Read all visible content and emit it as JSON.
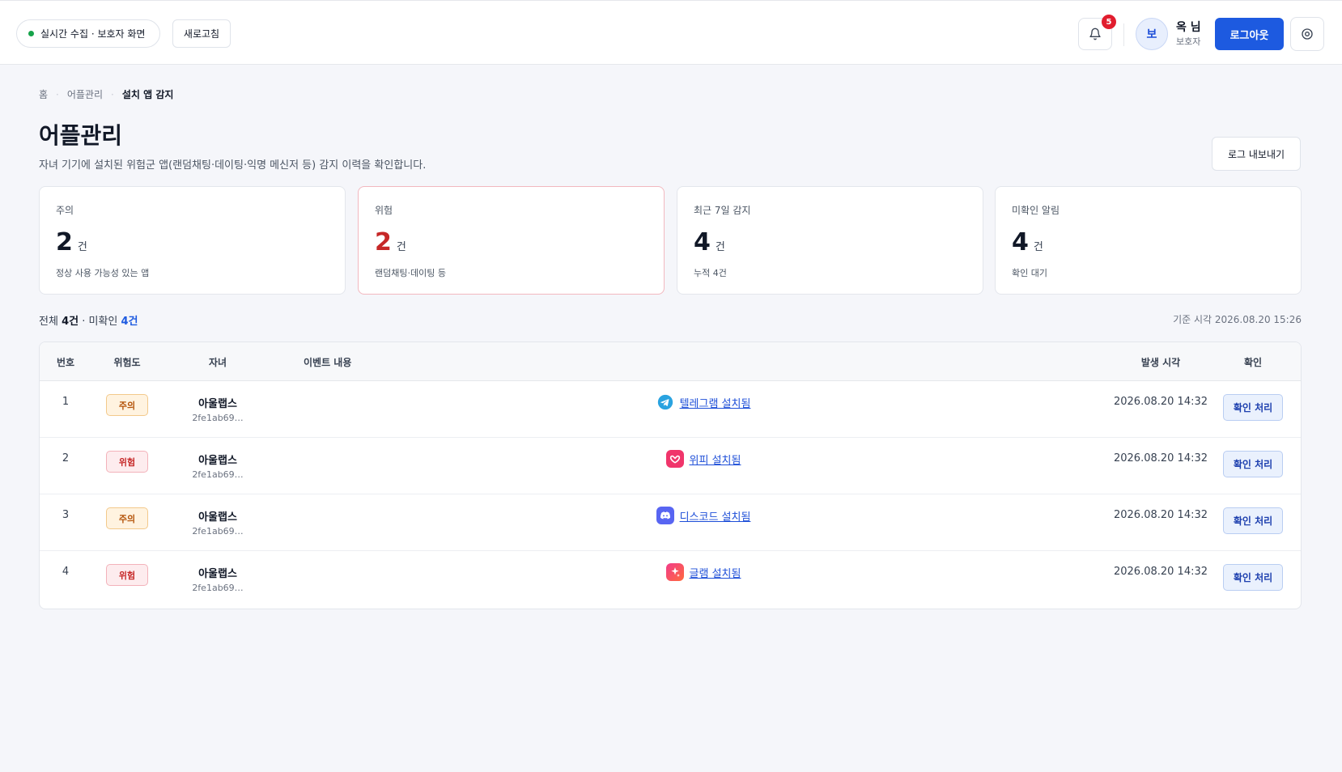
{
  "header": {
    "status_label": "실시간 수집 · 보호자 화면",
    "refresh_label": "새로고침",
    "notification_count": "5",
    "avatar_initial": "보",
    "user_name": "옥 님",
    "user_role": "보호자",
    "logout_label": "로그아웃"
  },
  "breadcrumb": [
    "홈",
    "어플관리",
    "설치 앱 감지"
  ],
  "page": {
    "title": "어플관리",
    "description": "자녀 기기에 설치된 위험군 앱(랜덤채팅·데이팅·익명 메신저 등) 감지 이력을 확인합니다.",
    "export_label": "로그 내보내기"
  },
  "stats": [
    {
      "label": "주의",
      "value": "2",
      "unit": "건",
      "sub": "정상 사용 가능성 있는 앱"
    },
    {
      "label": "위험",
      "value": "2",
      "unit": "건",
      "sub": "랜덤채팅·데이팅 등"
    },
    {
      "label": "최근 7일 감지",
      "value": "4",
      "unit": "건",
      "sub": "누적 4건"
    },
    {
      "label": "미확인 알림",
      "value": "4",
      "unit": "건",
      "sub": "확인 대기"
    }
  ],
  "summary": {
    "total_prefix": "전체",
    "total_value": "4건",
    "unread_prefix": "· 미확인",
    "unread_value": "4건",
    "timestamp": "기준 시각 2026.08.20 15:26"
  },
  "table": {
    "headers": [
      "번호",
      "위험도",
      "자녀",
      "이벤트 내용",
      "발생 시각",
      "확인"
    ],
    "rows": [
      {
        "no": "1",
        "risk": "주의",
        "child": "아울랩스",
        "child_id": "2fe1ab69…",
        "event": "텔레그램 설치됨",
        "icon": "telegram-icon",
        "time": "2026.08.20 14:32",
        "action": "확인 처리"
      },
      {
        "no": "2",
        "risk": "위험",
        "child": "아울랩스",
        "child_id": "2fe1ab69…",
        "event": "위피 설치됨",
        "icon": "wippy-icon",
        "time": "2026.08.20 14:32",
        "action": "확인 처리"
      },
      {
        "no": "3",
        "risk": "주의",
        "child": "아울랩스",
        "child_id": "2fe1ab69…",
        "event": "디스코드 설치됨",
        "icon": "discord-icon",
        "time": "2026.08.20 14:32",
        "action": "확인 처리"
      },
      {
        "no": "4",
        "risk": "위험",
        "child": "아울랩스",
        "child_id": "2fe1ab69…",
        "event": "글램 설치됨",
        "icon": "glam-icon",
        "time": "2026.08.20 14:32",
        "action": "확인 처리"
      }
    ]
  },
  "colors": {
    "primary": "#1d5ae0",
    "danger": "#c62828",
    "warning": "#b45309",
    "status_online": "#16a34a",
    "telegram": "#2aa3e0",
    "wippy": "#f0356b",
    "discord": "#5865f2",
    "glam": "#f23b8a"
  }
}
